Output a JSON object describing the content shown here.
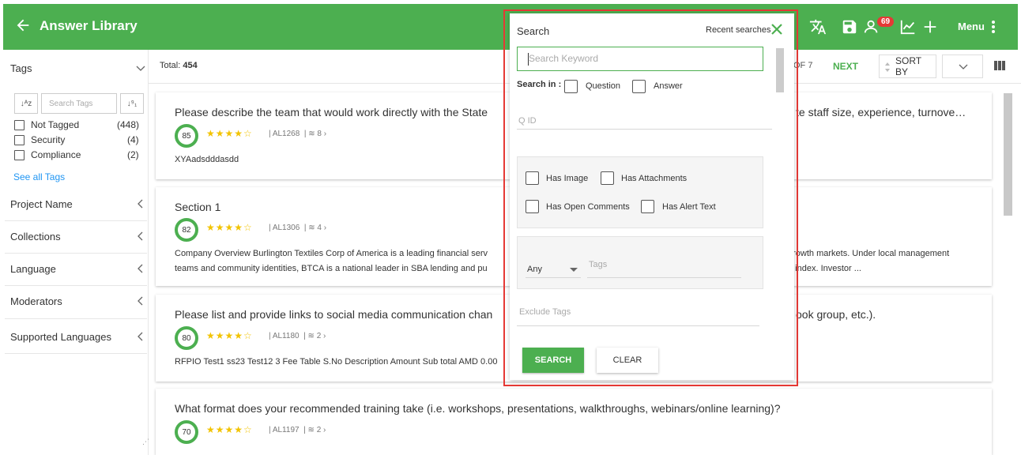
{
  "header": {
    "title": "Answer Library",
    "notification_count": "69",
    "menu_label": "Menu",
    "brand_color": "#4caf50",
    "icons": [
      "back-arrow-icon",
      "translate-icon",
      "save-icon",
      "user-icon",
      "chart-icon",
      "plus-icon",
      "more-vertical-icon"
    ]
  },
  "sidebar": {
    "tags_header": "Tags",
    "search_tags_placeholder": "Search Tags",
    "tags": [
      {
        "label": "Not Tagged",
        "count": "(448)"
      },
      {
        "label": "Security",
        "count": "(4)"
      },
      {
        "label": "Compliance",
        "count": "(2)"
      }
    ],
    "see_all": "See all Tags",
    "sections": [
      "Project Name",
      "Collections",
      "Language",
      "Moderators",
      "Supported Languages"
    ]
  },
  "toolbar": {
    "total_label": "Total:",
    "total_value": "454",
    "page_of": "OF 7",
    "next_label": "NEXT",
    "sort_label": "SORT BY"
  },
  "cards": [
    {
      "question": "Please describe the team that would work directly with the State",
      "question_end": "te staff size, experience, turnove…",
      "score": "85",
      "stars": "★★★★☆",
      "id": "AL1268",
      "versions": "8",
      "answer": "XYAadsdddasdd"
    },
    {
      "question": "Section 1",
      "question_end": "",
      "score": "82",
      "stars": "★★★★☆",
      "id": "AL1306",
      "versions": "4",
      "answer": "Company Overview Burlington Textiles Corp of America is a leading financial serv",
      "answer_end": "growth markets. Under local management",
      "answer2": "teams and community identities, BTCA is a national leader in SBA lending and pu",
      "answer2_end": "0 index. Investor ..."
    },
    {
      "question": "Please list and provide links to social media communication chan",
      "question_end": "ook group, etc.).",
      "score": "80",
      "stars": "★★★★☆",
      "id": "AL1180",
      "versions": "2",
      "answer": "RFPIO Test1 ss23 Test12 3 Fee Table S.No Description Amount Sub total AMD 0.00"
    },
    {
      "question": "What format does your recommended training take (i.e. workshops, presentations, walkthroughs, webinars/online learning)?",
      "question_end": "",
      "score": "70",
      "stars": "★★★★☆",
      "id": "AL1197",
      "versions": "2",
      "answer": ""
    }
  ],
  "search_panel": {
    "title": "Search",
    "recent_label": "Recent searches",
    "keyword_placeholder": "Search Keyword",
    "search_in_label": "Search in :",
    "search_in_options": [
      "Question",
      "Answer"
    ],
    "qid_placeholder": "Q ID",
    "flags": [
      "Has Image",
      "Has Attachments",
      "Has Open Comments",
      "Has Alert Text"
    ],
    "match_select": "Any",
    "tags_placeholder": "Tags",
    "exclude_tags_placeholder": "Exclude Tags",
    "search_button": "SEARCH",
    "clear_button": "CLEAR",
    "highlight_color": "#e53935"
  }
}
